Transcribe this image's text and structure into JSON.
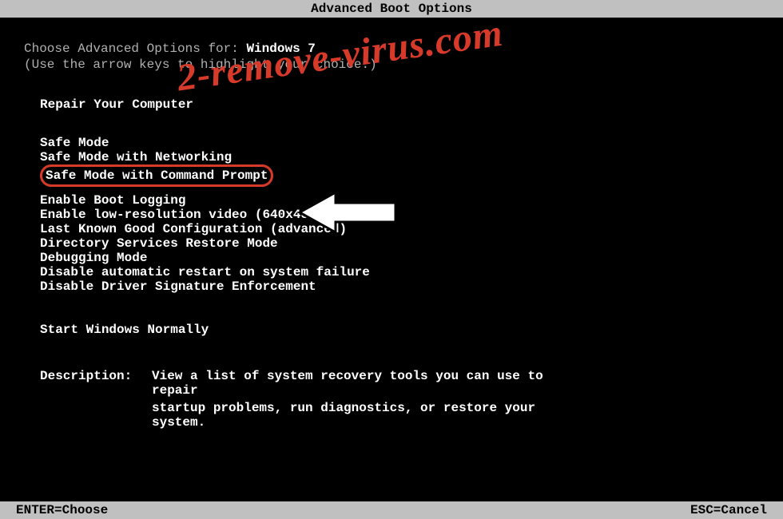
{
  "title": "Advanced Boot Options",
  "header": {
    "prefix": "Choose Advanced Options for: ",
    "os": "Windows 7",
    "hint": "(Use the arrow keys to highlight your choice.)"
  },
  "repair": "Repair Your Computer",
  "options": {
    "safe_mode": "Safe Mode",
    "safe_mode_net": "Safe Mode with Networking",
    "safe_mode_cmd": "Safe Mode with Command Prompt",
    "boot_log": "Enable Boot Logging",
    "low_res": "Enable low-resolution video (640x480)",
    "lkgc": "Last Known Good Configuration (advanced)",
    "ds_restore": "Directory Services Restore Mode",
    "debug": "Debugging Mode",
    "no_auto_restart": "Disable automatic restart on system failure",
    "no_sig_enforce": "Disable Driver Signature Enforcement",
    "start_normal": "Start Windows Normally"
  },
  "description": {
    "label": "Description:",
    "line1": "View a list of system recovery tools you can use to repair",
    "line2": "startup problems, run diagnostics, or restore your system."
  },
  "footer": {
    "enter": "ENTER=Choose",
    "esc": "ESC=Cancel"
  },
  "watermark": "2-remove-virus.com",
  "colors": {
    "accent": "#d83a2a",
    "barBg": "#c0c0c0",
    "text": "#b0b0b0",
    "bright": "#ffffff"
  }
}
